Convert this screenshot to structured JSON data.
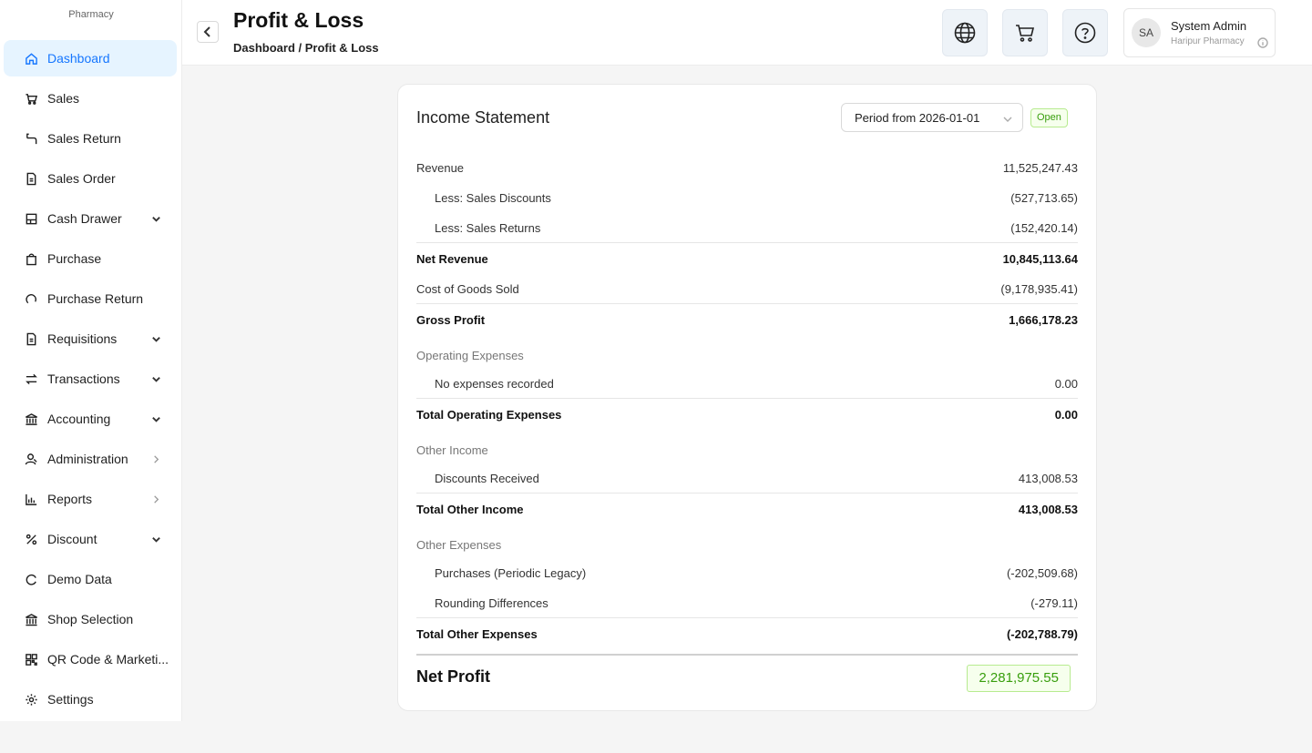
{
  "brand": {
    "subtitle": "Pharmacy"
  },
  "sidebar": {
    "items": [
      {
        "label": "Dashboard",
        "icon": "home-icon",
        "active": true,
        "chevron": "none"
      },
      {
        "label": "Sales",
        "icon": "cart-icon",
        "chevron": "none"
      },
      {
        "label": "Sales Return",
        "icon": "return-icon",
        "chevron": "none"
      },
      {
        "label": "Sales Order",
        "icon": "document-icon",
        "chevron": "none"
      },
      {
        "label": "Cash Drawer",
        "icon": "cash-drawer-icon",
        "chevron": "down"
      },
      {
        "label": "Purchase",
        "icon": "bag-icon",
        "chevron": "none"
      },
      {
        "label": "Purchase Return",
        "icon": "refresh-icon",
        "chevron": "none"
      },
      {
        "label": "Requisitions",
        "icon": "document-icon",
        "chevron": "down"
      },
      {
        "label": "Transactions",
        "icon": "swap-icon",
        "chevron": "down"
      },
      {
        "label": "Accounting",
        "icon": "bank-icon",
        "chevron": "down"
      },
      {
        "label": "Administration",
        "icon": "user-admin-icon",
        "chevron": "right"
      },
      {
        "label": "Reports",
        "icon": "bar-chart-icon",
        "chevron": "right"
      },
      {
        "label": "Discount",
        "icon": "percent-icon",
        "chevron": "down"
      },
      {
        "label": "Demo Data",
        "icon": "reload-icon",
        "chevron": "none"
      },
      {
        "label": "Shop Selection",
        "icon": "shop-icon",
        "chevron": "none"
      },
      {
        "label": "QR Code & Marketi...",
        "icon": "qr-code-icon",
        "chevron": "none"
      },
      {
        "label": "Settings",
        "icon": "gear-icon",
        "chevron": "none"
      }
    ]
  },
  "header": {
    "title": "Profit & Loss",
    "breadcrumb": "Dashboard / Profit & Loss",
    "user": {
      "initials": "SA",
      "name": "System Admin",
      "shop": "Haripur Pharmacy"
    }
  },
  "statement": {
    "title": "Income Statement",
    "period": "Period from 2026-01-01",
    "status": "Open",
    "rows": [
      {
        "label": "Revenue",
        "value": "11,525,247.43",
        "kind": "normal"
      },
      {
        "label": "Less: Sales Discounts",
        "value": "(527,713.65)",
        "kind": "indent"
      },
      {
        "label": "Less: Sales Returns",
        "value": "(152,420.14)",
        "kind": "indent"
      },
      {
        "label": "Net Revenue",
        "value": "10,845,113.64",
        "kind": "bold"
      },
      {
        "label": "Cost of Goods Sold",
        "value": "(9,178,935.41)",
        "kind": "normal"
      },
      {
        "label": "Gross Profit",
        "value": "1,666,178.23",
        "kind": "bold"
      },
      {
        "label": "Operating Expenses",
        "value": "",
        "kind": "section"
      },
      {
        "label": "No expenses recorded",
        "value": "0.00",
        "kind": "indent"
      },
      {
        "label": "Total Operating Expenses",
        "value": "0.00",
        "kind": "bold"
      },
      {
        "label": "Other Income",
        "value": "",
        "kind": "section"
      },
      {
        "label": "Discounts Received",
        "value": "413,008.53",
        "kind": "indent"
      },
      {
        "label": "Total Other Income",
        "value": "413,008.53",
        "kind": "bold"
      },
      {
        "label": "Other Expenses",
        "value": "",
        "kind": "section"
      },
      {
        "label": "Purchases (Periodic Legacy)",
        "value": "(-202,509.68)",
        "kind": "indent"
      },
      {
        "label": "Rounding Differences",
        "value": "(-279.11)",
        "kind": "indent"
      },
      {
        "label": "Total Other Expenses",
        "value": "(-202,788.79)",
        "kind": "bold"
      }
    ],
    "net_profit": {
      "label": "Net Profit",
      "value": "2,281,975.55"
    }
  },
  "colors": {
    "accent": "#1677ff",
    "positive": "#389e0d",
    "positive_bg": "#f6ffed"
  }
}
